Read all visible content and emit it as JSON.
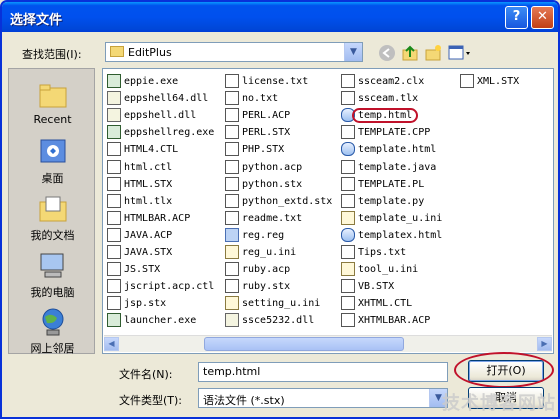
{
  "window": {
    "title": "选择文件"
  },
  "lookin": {
    "label": "查找范围(I):",
    "value": "EditPlus"
  },
  "places": [
    "Recent",
    "桌面",
    "我的文档",
    "我的电脑",
    "网上邻居"
  ],
  "files": [
    [
      "eppie.exe",
      "eppshell64.dll",
      "eppshell.dll",
      "eppshellreg.exe",
      "HTML4.CTL",
      "html.ctl",
      "HTML.STX",
      "html.tlx",
      "HTMLBAR.ACP",
      "JAVA.ACP",
      "JAVA.STX",
      "JS.STX",
      "jscript.acp.ctl",
      "jsp.stx",
      "launcher.exe"
    ],
    [
      "license.txt",
      "no.txt",
      "PERL.ACP",
      "PERL.STX",
      "PHP.STX",
      "python.acp",
      "python.stx",
      "python_extd.stx",
      "readme.txt",
      "reg.reg",
      "reg_u.ini",
      "ruby.acp",
      "ruby.stx",
      "setting_u.ini",
      "ssce5232.dll"
    ],
    [
      "ssceam2.clx",
      "ssceam.tlx",
      "temp.html",
      "TEMPLATE.CPP",
      "template.html",
      "template.java",
      "TEMPLATE.PL",
      "template.py",
      "template_u.ini",
      "templatex.html",
      "Tips.txt",
      "tool_u.ini",
      "VB.STX",
      "XHTML.CTL",
      "XHTMLBAR.ACP"
    ],
    [
      "XML.STX"
    ]
  ],
  "filename": {
    "label": "文件名(N):",
    "value": "temp.html"
  },
  "filetype": {
    "label": "文件类型(T):",
    "value": "语法文件 (*.stx)"
  },
  "buttons": {
    "open": "打开(O)",
    "cancel": "取消"
  },
  "watermark": "技术博客网站"
}
